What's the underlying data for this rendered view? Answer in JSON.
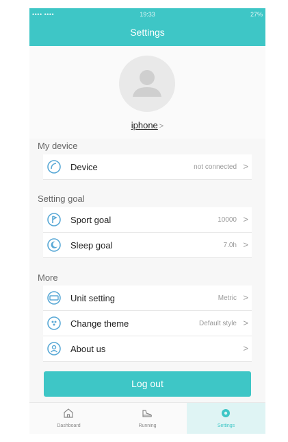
{
  "status_bar": {
    "carrier": "•••• ••••",
    "time": "19:33",
    "battery": "27%"
  },
  "header": {
    "title": "Settings"
  },
  "profile": {
    "name": "iphone",
    "chevron": ">"
  },
  "sections": {
    "my_device": {
      "title": "My device",
      "rows": [
        {
          "label": "Device",
          "value": "not connected",
          "icon": "device-icon"
        }
      ]
    },
    "setting_goal": {
      "title": "Setting goal",
      "rows": [
        {
          "label": "Sport goal",
          "value": "10000",
          "icon": "sport-goal-icon"
        },
        {
          "label": "Sleep goal",
          "value": "7.0h",
          "icon": "sleep-goal-icon"
        }
      ]
    },
    "more": {
      "title": "More",
      "rows": [
        {
          "label": "Unit setting",
          "value": "Metric",
          "icon": "unit-setting-icon"
        },
        {
          "label": "Change theme",
          "value": "Default style",
          "icon": "theme-icon"
        },
        {
          "label": "About us",
          "value": "",
          "icon": "about-icon"
        }
      ]
    }
  },
  "chevron": ">",
  "logout_label": "Log out",
  "tabs": [
    {
      "label": "Dashboard",
      "icon": "home-icon"
    },
    {
      "label": "Running",
      "icon": "running-shoe-icon"
    },
    {
      "label": "Settings",
      "icon": "settings-icon"
    }
  ],
  "colors": {
    "accent": "#3ec6c6",
    "icon": "#5aa9d6",
    "background": "#f7f7f7"
  }
}
